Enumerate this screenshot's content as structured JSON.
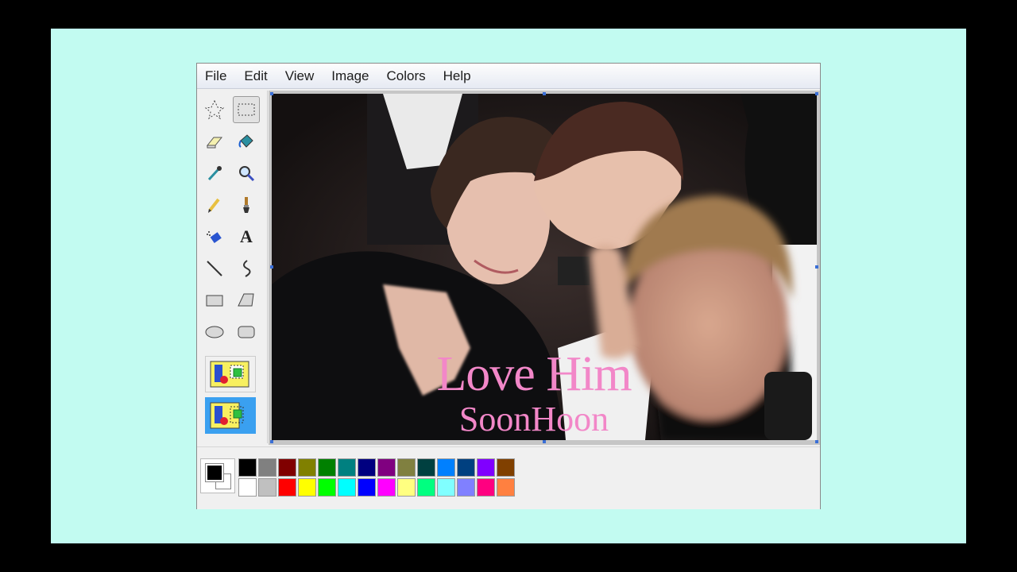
{
  "menu": {
    "file": "File",
    "edit": "Edit",
    "view": "View",
    "image": "Image",
    "colors": "Colors",
    "help": "Help"
  },
  "tools": [
    {
      "name": "free-select-icon"
    },
    {
      "name": "rect-select-icon",
      "selected": true
    },
    {
      "name": "eraser-icon"
    },
    {
      "name": "fill-bucket-icon"
    },
    {
      "name": "eyedropper-icon"
    },
    {
      "name": "magnifier-icon"
    },
    {
      "name": "pencil-icon"
    },
    {
      "name": "brush-icon"
    },
    {
      "name": "airbrush-icon"
    },
    {
      "name": "text-icon"
    },
    {
      "name": "line-icon"
    },
    {
      "name": "curve-icon"
    },
    {
      "name": "rectangle-icon"
    },
    {
      "name": "polygon-icon"
    },
    {
      "name": "ellipse-icon"
    },
    {
      "name": "rounded-rect-icon"
    }
  ],
  "text_tool_glyph": "A",
  "canvas": {
    "title": "Love Him",
    "subtitle": "SoonHoon"
  },
  "palette": {
    "foreground": "#000000",
    "background": "#ffffff",
    "top_row": [
      "#000000",
      "#808080",
      "#800000",
      "#808000",
      "#008000",
      "#008080",
      "#000080",
      "#800080",
      "#808040",
      "#004040",
      "#0080ff",
      "#004080",
      "#8000ff",
      "#804000"
    ],
    "bottom_row": [
      "#ffffff",
      "#c0c0c0",
      "#ff0000",
      "#ffff00",
      "#00ff00",
      "#00ffff",
      "#0000ff",
      "#ff00ff",
      "#ffff80",
      "#00ff80",
      "#80ffff",
      "#8080ff",
      "#ff0080",
      "#ff8040"
    ]
  },
  "colors": {
    "stage_background": "#c2fbf1",
    "overlay_text": "#f287c8"
  }
}
